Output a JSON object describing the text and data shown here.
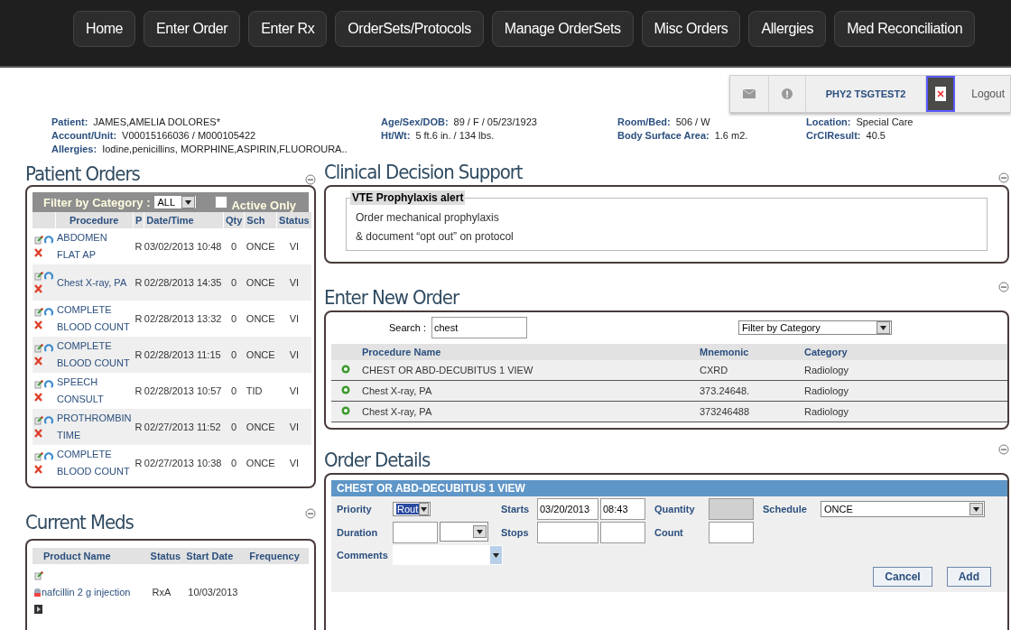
{
  "nav": [
    "Home",
    "Enter Order",
    "Enter Rx",
    "OrderSets/Protocols",
    "Manage OrderSets",
    "Misc Orders",
    "Allergies",
    "Med Reconciliation"
  ],
  "user_bar": {
    "user": "PHY2 TSGTEST2",
    "logout": "Logout"
  },
  "patient_info": {
    "columns": [
      [
        {
          "label": "Patient:",
          "value": "JAMES,AMELIA DOLORES*"
        },
        {
          "label": "Account/Unit:",
          "value": "V00015166036 / M000105422"
        }
      ],
      [
        {
          "label": "Age/Sex/DOB:",
          "value": "89 / F / 05/23/1923"
        },
        {
          "label": "Ht/Wt:",
          "value": "5 ft.6 in. / 134 lbs."
        }
      ],
      [
        {
          "label": "Room/Bed:",
          "value": "506 / W"
        },
        {
          "label": "Body Surface Area:",
          "value": "1.6 m2."
        }
      ],
      [
        {
          "label": "Location:",
          "value": "Special Care"
        },
        {
          "label": "CrClResult:",
          "value": "40.5"
        }
      ]
    ],
    "allergies": {
      "label": "Allergies:",
      "value": "Iodine,penicillins, MORPHINE,ASPIRIN,FLUOROURA.."
    }
  },
  "patient_orders": {
    "title": "Patient Orders",
    "filter_label": "Filter by Category :",
    "filter_value": "ALL",
    "active_only": {
      "label": "Active Only",
      "checked": false
    },
    "columns": [
      "Procedure",
      "P",
      "Date/Time",
      "Qty",
      "Sch",
      "Status"
    ],
    "rows": [
      {
        "procedure": "ABDOMEN FLAT AP",
        "p": "R",
        "datetime": "03/02/2013 10:48",
        "qty": "0",
        "sch": "ONCE",
        "status": "VI"
      },
      {
        "procedure": "Chest X-ray, PA",
        "p": "R",
        "datetime": "02/28/2013 14:35",
        "qty": "0",
        "sch": "ONCE",
        "status": "VI"
      },
      {
        "procedure": "COMPLETE BLOOD COUNT",
        "p": "R",
        "datetime": "02/28/2013 13:32",
        "qty": "0",
        "sch": "ONCE",
        "status": "VI"
      },
      {
        "procedure": "COMPLETE BLOOD COUNT",
        "p": "R",
        "datetime": "02/28/2013 11:15",
        "qty": "0",
        "sch": "ONCE",
        "status": "VI"
      },
      {
        "procedure": "SPEECH CONSULT",
        "p": "R",
        "datetime": "02/28/2013 10:57",
        "qty": "0",
        "sch": "TID",
        "status": "VI"
      },
      {
        "procedure": "PROTHROMBIN TIME",
        "p": "R",
        "datetime": "02/27/2013 11:52",
        "qty": "0",
        "sch": "ONCE",
        "status": "VI"
      },
      {
        "procedure": "COMPLETE BLOOD COUNT",
        "p": "R",
        "datetime": "02/27/2013 10:38",
        "qty": "0",
        "sch": "ONCE",
        "status": "VI"
      }
    ]
  },
  "current_meds": {
    "title": "Current Meds",
    "columns": [
      "Product Name",
      "Status",
      "Start Date",
      "Frequency"
    ],
    "rows": [
      {
        "product": "nafcillin 2 g injection",
        "status": "RxA",
        "start_date": "10/03/2013"
      }
    ]
  },
  "clinical_decision_support": {
    "title": "Clinical Decision Support",
    "alert": {
      "title": "VTE Prophylaxis alert",
      "lines": [
        "Order mechanical prophylaxis",
        "& document “opt out” on protocol"
      ]
    }
  },
  "new_order": {
    "title": "Enter New Order",
    "search_label": "Search :",
    "search_value": "chest",
    "category_placeholder": "Filter by Category",
    "columns": [
      "Procedure Name",
      "Mnemonic",
      "Category"
    ],
    "rows": [
      {
        "name": "CHEST OR ABD-DECUBITUS 1 VIEW",
        "mnemonic": "CXRD",
        "category": "Radiology"
      },
      {
        "name": "Chest X-ray, PA",
        "mnemonic": "373.24648.",
        "category": "Radiology"
      },
      {
        "name": "Chest X-ray, PA",
        "mnemonic": "373246488",
        "category": "Radiology"
      }
    ]
  },
  "order_details": {
    "title": "Order Details",
    "header": "CHEST OR ABD-DECUBITUS 1 VIEW",
    "priority": {
      "label": "Priority",
      "value": "Rout"
    },
    "starts": {
      "label": "Starts",
      "date": "03/20/2013",
      "time": "08:43"
    },
    "quantity": {
      "label": "Quantity",
      "disabled": true
    },
    "schedule": {
      "label": "Schedule",
      "value": "ONCE"
    },
    "duration": {
      "label": "Duration"
    },
    "stops": {
      "label": "Stops"
    },
    "count": {
      "label": "Count"
    },
    "comments": {
      "label": "Comments"
    },
    "buttons": [
      "Cancel",
      "Add"
    ]
  }
}
